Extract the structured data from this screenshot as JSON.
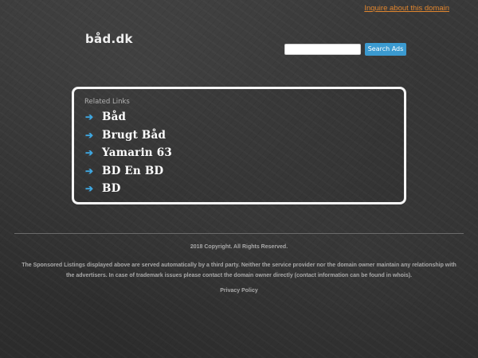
{
  "header": {
    "inquire_link": "Inquire about this domain",
    "logo": "båd.dk"
  },
  "search": {
    "placeholder": "",
    "button_label": "Search Ads"
  },
  "related_links": {
    "title": "Related Links",
    "items": [
      {
        "label": "Båd"
      },
      {
        "label": "Brugt Båd"
      },
      {
        "label": "Yamarin 63"
      },
      {
        "label": "BD En BD"
      },
      {
        "label": "BD"
      }
    ]
  },
  "footer": {
    "copyright": "2018 Copyright. All Rights Reserved.",
    "disclaimer": "The Sponsored Listings displayed above are served automatically by a third party. Neither the service provider nor the domain owner maintain any relationship with the advertisers. In case of trademark issues please contact the domain owner directly (contact information can be found in whois).",
    "privacy": "Privacy Policy"
  },
  "colors": {
    "accent_orange": "#e0862f",
    "accent_blue": "#3b9ad0",
    "arrow_blue": "#3fa7e0"
  }
}
